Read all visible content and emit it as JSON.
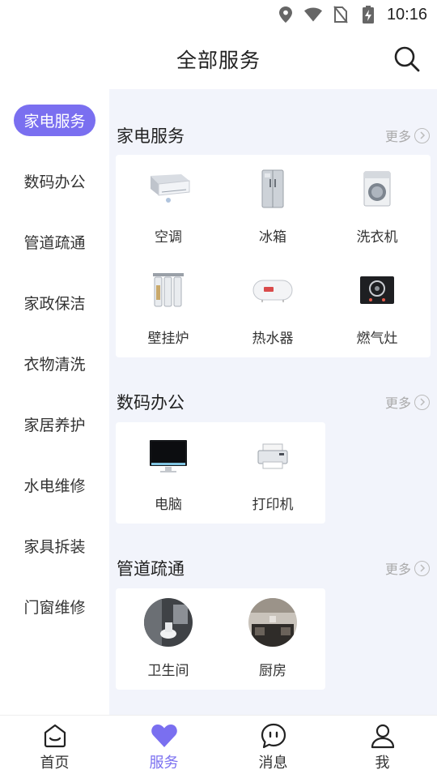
{
  "status_bar": {
    "time": "10:16"
  },
  "header": {
    "title": "全部服务"
  },
  "sidebar": {
    "items": [
      {
        "label": "家电服务",
        "active": true
      },
      {
        "label": "数码办公"
      },
      {
        "label": "管道疏通"
      },
      {
        "label": "家政保洁"
      },
      {
        "label": "衣物清洗"
      },
      {
        "label": "家居养护"
      },
      {
        "label": "水电维修"
      },
      {
        "label": "家具拆装"
      },
      {
        "label": "门窗维修"
      }
    ]
  },
  "sections": [
    {
      "title": "家电服务",
      "more": "更多",
      "items": [
        {
          "label": "空调",
          "icon": "air-conditioner-icon"
        },
        {
          "label": "冰箱",
          "icon": "fridge-icon"
        },
        {
          "label": "洗衣机",
          "icon": "washing-machine-icon"
        },
        {
          "label": "壁挂炉",
          "icon": "water-filter-icon"
        },
        {
          "label": "热水器",
          "icon": "water-heater-icon"
        },
        {
          "label": "燃气灶",
          "icon": "gas-stove-icon"
        }
      ]
    },
    {
      "title": "数码办公",
      "more": "更多",
      "items": [
        {
          "label": "电脑",
          "icon": "computer-icon"
        },
        {
          "label": "打印机",
          "icon": "printer-icon"
        }
      ]
    },
    {
      "title": "管道疏通",
      "more": "更多",
      "items": [
        {
          "label": "卫生间",
          "icon": "bathroom-photo"
        },
        {
          "label": "厨房",
          "icon": "kitchen-photo"
        }
      ]
    }
  ],
  "bottom_nav": [
    {
      "label": "首页",
      "icon": "home-icon"
    },
    {
      "label": "服务",
      "icon": "heart-icon",
      "active": true
    },
    {
      "label": "消息",
      "icon": "message-icon"
    },
    {
      "label": "我",
      "icon": "user-icon"
    }
  ],
  "colors": {
    "accent": "#7a6ff0",
    "content_bg": "#f2f4fb"
  }
}
